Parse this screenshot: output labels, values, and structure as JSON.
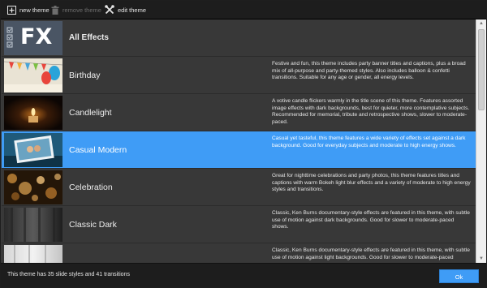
{
  "toolbar": {
    "new_theme": "new theme",
    "remove_theme": "remove theme",
    "edit_theme": "edit theme"
  },
  "themes": [
    {
      "title": "All Effects",
      "description": ""
    },
    {
      "title": "Birthday",
      "description": "Festive and fun, this theme includes party banner titles and captions, plus a broad mix of all-purpose and party-themed styles. Also includes balloon & confetti transitions. Suitable for any age or gender, all energy levels."
    },
    {
      "title": "Candlelight",
      "description": "A votive candle flickers warmly in the title scene of this theme. Features assorted image effects with dark backgrounds, best for quieter, more contemplative subjects. Recommended for memorial, tribute and retrospective shows, slower to moderate-paced."
    },
    {
      "title": "Casual Modern",
      "description": "Casual yet tasteful, this theme features a wide variety of effects set against a dark background. Good for everyday subjects and moderate to high energy shows."
    },
    {
      "title": "Celebration",
      "description": "Great for nighttime celebrations and party photos, this theme features titles and captions with warm Bokeh light blur effects and a variety of moderate to high energy styles and transitions."
    },
    {
      "title": "Classic Dark",
      "description": "Classic, Ken Burns documentary-style effects are featured in this theme, with subtle use of motion against dark backgrounds. Good for slower to moderate-paced shows."
    },
    {
      "title": "",
      "description": "Classic, Ken Burns documentary-style effects are featured in this theme, with subtle use of motion against light backgrounds. Good for slower to moderate-paced"
    }
  ],
  "selected_theme": "Casual Modern",
  "fx_label": "FX",
  "status": {
    "text": "This theme has 35 slide styles and 41 transitions",
    "ok_label": "Ok"
  },
  "colors": {
    "accent": "#3f9cf6",
    "row_bg": "#383838",
    "toolbar_bg": "#1d1d1d"
  }
}
